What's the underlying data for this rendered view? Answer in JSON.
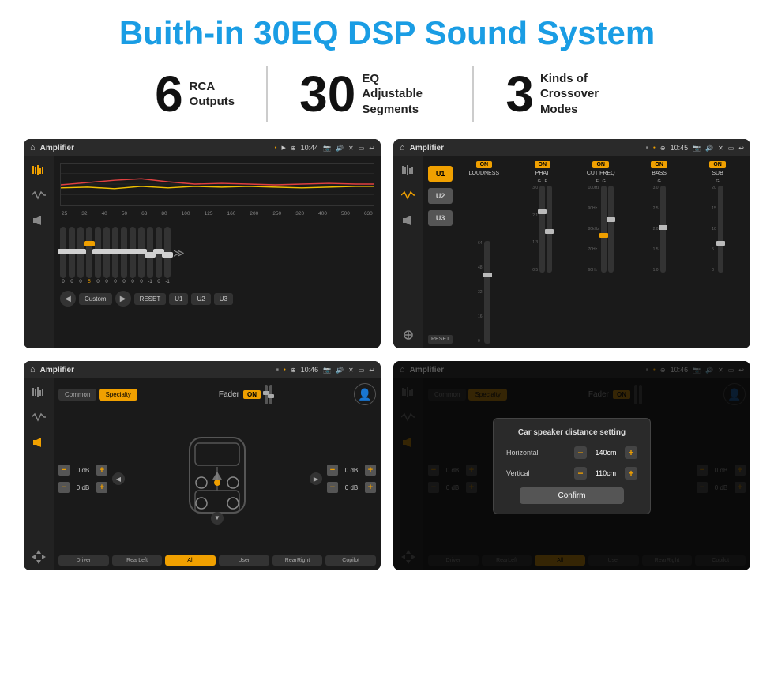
{
  "title": "Buith-in 30EQ DSP Sound System",
  "stats": [
    {
      "number": "6",
      "label": "RCA\nOutputs"
    },
    {
      "number": "30",
      "label": "EQ Adjustable\nSegments"
    },
    {
      "number": "3",
      "label": "Kinds of\nCrossover Modes"
    }
  ],
  "screens": {
    "eq": {
      "topbar": {
        "title": "Amplifier",
        "time": "10:44"
      },
      "freq_labels": [
        "25",
        "32",
        "40",
        "50",
        "63",
        "80",
        "100",
        "125",
        "160",
        "200",
        "250",
        "320",
        "400",
        "500",
        "630"
      ],
      "slider_values": [
        "0",
        "0",
        "0",
        "5",
        "0",
        "0",
        "0",
        "0",
        "0",
        "0",
        "-1",
        "0",
        "-1"
      ],
      "buttons": [
        "Custom",
        "RESET",
        "U1",
        "U2",
        "U3"
      ]
    },
    "crossover": {
      "topbar": {
        "title": "Amplifier",
        "time": "10:45"
      },
      "presets": [
        "U1",
        "U2",
        "U3"
      ],
      "channels": [
        {
          "on": true,
          "label": "LOUDNESS"
        },
        {
          "on": true,
          "label": "PHAT"
        },
        {
          "on": true,
          "label": "CUT FREQ"
        },
        {
          "on": true,
          "label": "BASS"
        },
        {
          "on": true,
          "label": "SUB"
        }
      ],
      "reset_label": "RESET"
    },
    "fader": {
      "topbar": {
        "title": "Amplifier",
        "time": "10:46"
      },
      "tabs": [
        "Common",
        "Specialty"
      ],
      "fader_label": "Fader",
      "on_label": "ON",
      "db_values": [
        "0 dB",
        "0 dB",
        "0 dB",
        "0 dB"
      ],
      "bottom_btns": [
        "Driver",
        "RearLeft",
        "All",
        "User",
        "RearRight",
        "Copilot"
      ]
    },
    "distance": {
      "topbar": {
        "title": "Amplifier",
        "time": "10:46"
      },
      "tabs": [
        "Common",
        "Specialty"
      ],
      "modal": {
        "title": "Car speaker distance setting",
        "horizontal_label": "Horizontal",
        "horizontal_value": "140cm",
        "vertical_label": "Vertical",
        "vertical_value": "110cm",
        "confirm_label": "Confirm"
      },
      "bottom_btns": [
        "Driver",
        "RearLeft",
        "All",
        "User",
        "RearRight",
        "Copilot"
      ]
    }
  }
}
